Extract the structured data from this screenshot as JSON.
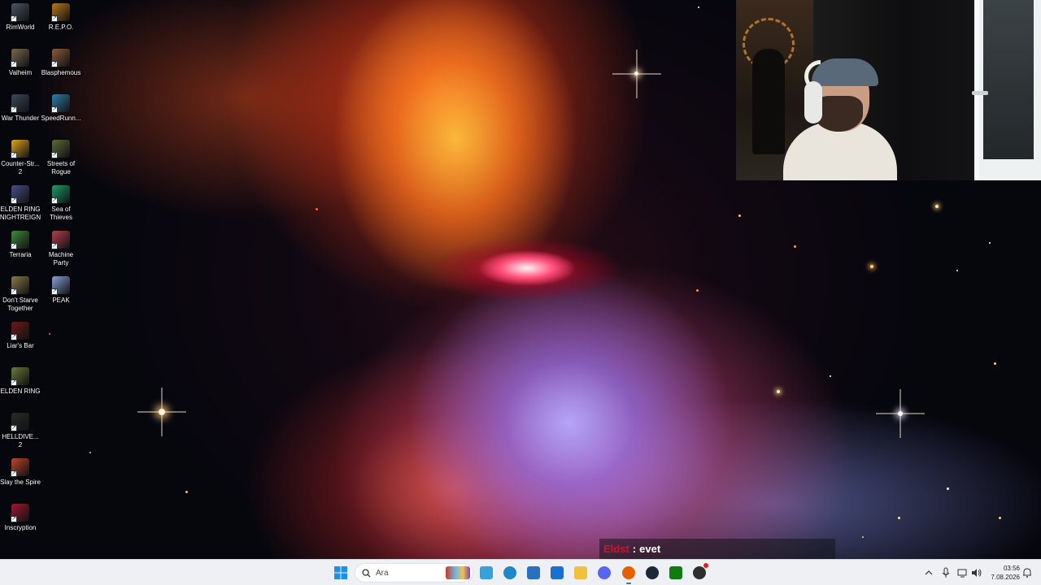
{
  "desktop_icons": [
    {
      "label": "RimWorld",
      "icon": "rimworld-icon",
      "color": "#4b5563"
    },
    {
      "label": "R.E.P.O.",
      "icon": "repo-icon",
      "color": "#b7791f"
    },
    {
      "label": "Valheim",
      "icon": "valheim-icon",
      "color": "#7a6a4f"
    },
    {
      "label": "Blasphemous",
      "icon": "blasphemous-icon",
      "color": "#8a5a3a"
    },
    {
      "label": "War Thunder",
      "icon": "war-thunder-icon",
      "color": "#3b4a5a"
    },
    {
      "label": "SpeedRunn...",
      "icon": "speedrunners-icon",
      "color": "#2f7fa8"
    },
    {
      "label": "Counter-Str...\n2",
      "icon": "counter-strike-icon",
      "color": "#e0a422"
    },
    {
      "label": "Streets of\nRogue",
      "icon": "streets-of-rogue-icon",
      "color": "#5a6a3a"
    },
    {
      "label": "ELDEN RING\nNIGHTREIGN",
      "icon": "elden-ring-nightreign-icon",
      "color": "#4a4f8a"
    },
    {
      "label": "Sea of\nThieves",
      "icon": "sea-of-thieves-icon",
      "color": "#1f9d6b"
    },
    {
      "label": "Terraria",
      "icon": "terraria-icon",
      "color": "#3c8a3c"
    },
    {
      "label": "Machine\nParty",
      "icon": "machine-party-icon",
      "color": "#b04050"
    },
    {
      "label": "Don't Starve\nTogether",
      "icon": "dont-starve-together-icon",
      "color": "#8a7a4a"
    },
    {
      "label": "PEAK",
      "icon": "peak-icon",
      "color": "#8aa0d8"
    },
    {
      "label": "Liar's Bar",
      "icon": "liars-bar-icon",
      "color": "#6a1a1a"
    },
    {
      "label": "ELDEN RING",
      "icon": "elden-ring-icon",
      "color": "#6a7a3a"
    },
    {
      "label": "HELLDIVE...\n2",
      "icon": "helldivers-icon",
      "color": "#2a2a2a"
    },
    {
      "label": "Slay the Spire",
      "icon": "slay-the-spire-icon",
      "color": "#c0452a"
    },
    {
      "label": "Inscryption",
      "icon": "inscryption-icon",
      "color": "#a01830"
    }
  ],
  "chat": {
    "username": "Eldst",
    "separator": ":",
    "message": "evet"
  },
  "taskbar": {
    "search_placeholder": "Ara",
    "apps": [
      {
        "name": "start-icon",
        "color": "#1f8fe0"
      },
      {
        "name": "copilot-icon",
        "color": "#3aa0d8"
      },
      {
        "name": "edge-icon",
        "color": "#1e88c8"
      },
      {
        "name": "store-icon",
        "color": "#2a6fc0"
      },
      {
        "name": "outlook-icon",
        "color": "#1a6fd0"
      },
      {
        "name": "file-explorer-icon",
        "color": "#f0c040"
      },
      {
        "name": "discord-icon",
        "color": "#5865f2"
      },
      {
        "name": "firefox-icon",
        "color": "#e66000"
      },
      {
        "name": "steam-icon",
        "color": "#1b2838"
      },
      {
        "name": "xbox-icon",
        "color": "#107c10"
      },
      {
        "name": "obs-icon",
        "color": "#302e31"
      }
    ],
    "clock": {
      "time": "03:56",
      "date": "7.08.2026"
    }
  }
}
